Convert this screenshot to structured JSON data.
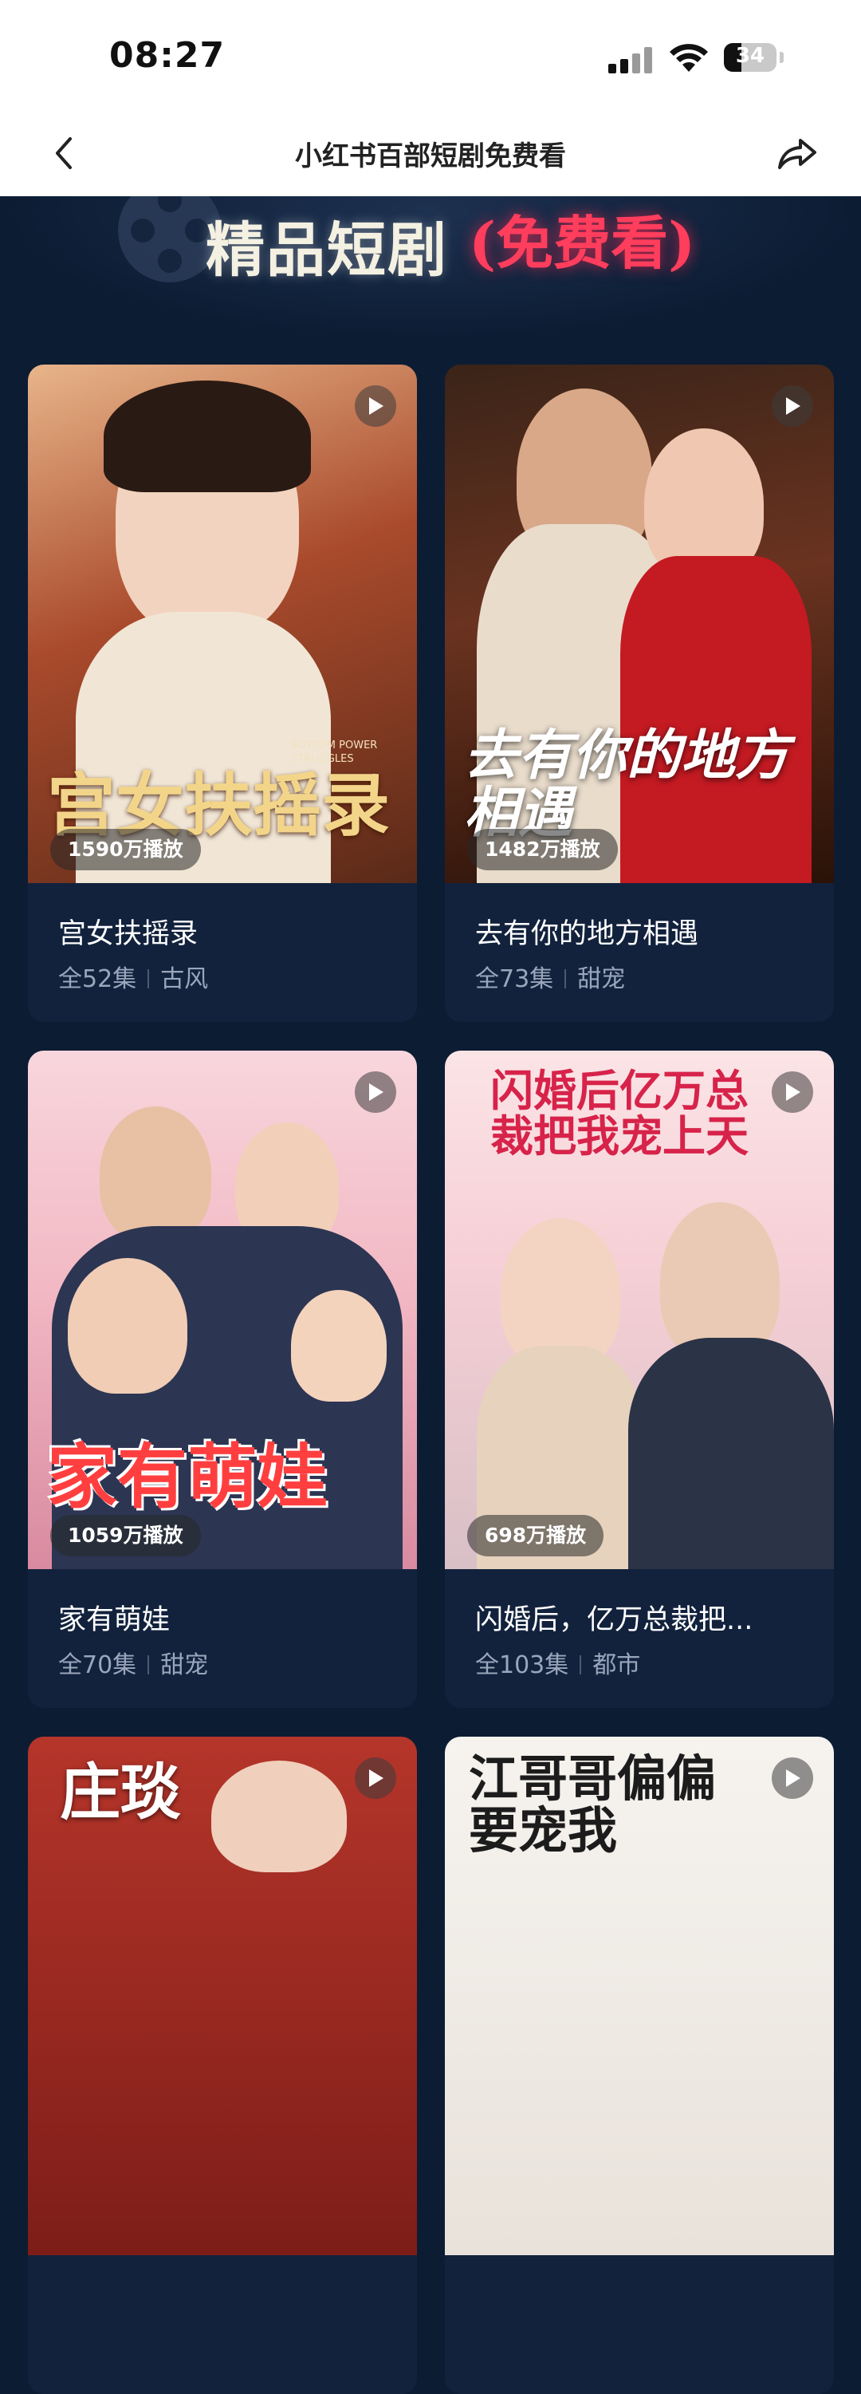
{
  "status_bar": {
    "time": "08:27",
    "battery": "34",
    "battery_level": 0.34
  },
  "nav": {
    "title": "小红书百部短剧免费看"
  },
  "banner": {
    "title": "精品短剧",
    "subtitle": "(免费看)"
  },
  "cards": [
    {
      "poster_title": "宫女扶摇录",
      "poster_caption": "BOTTOM POWER STRUGGLES",
      "views": "1590万播放",
      "title": "宫女扶摇录",
      "episodes": "全52集",
      "genre": "古风"
    },
    {
      "poster_title": "去有你的地方相遇",
      "views": "1482万播放",
      "title": "去有你的地方相遇",
      "episodes": "全73集",
      "genre": "甜宠"
    },
    {
      "poster_title": "家有萌娃",
      "views": "1059万播放",
      "title": "家有萌娃",
      "episodes": "全70集",
      "genre": "甜宠"
    },
    {
      "poster_title": "闪婚后亿万总裁把我宠上天",
      "views": "698万播放",
      "title": "闪婚后，亿万总裁把...",
      "episodes": "全103集",
      "genre": "都市"
    },
    {
      "poster_title": "庄琰"
    },
    {
      "poster_title": "江哥哥偏偏要宠我"
    }
  ],
  "colors": {
    "background": "#0c1c33",
    "card": "#12223d",
    "accent_red": "#ff3d5c"
  },
  "icons": [
    "back-arrow-icon",
    "share-icon",
    "play-icon",
    "signal-icon",
    "wifi-icon",
    "battery-icon"
  ]
}
